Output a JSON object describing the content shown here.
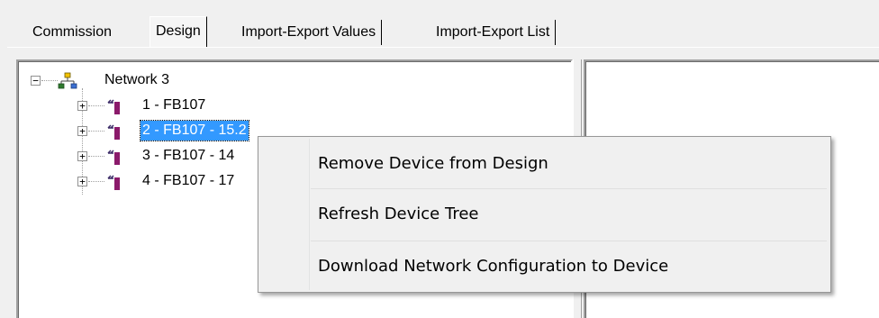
{
  "tabs": [
    {
      "label": "Commission",
      "active": false
    },
    {
      "label": "Design",
      "active": true
    },
    {
      "label": "Import-Export Values",
      "active": false
    },
    {
      "label": "Import-Export List",
      "active": false
    }
  ],
  "tree": {
    "root": {
      "label": "Network 3",
      "icon": "network-icon",
      "expanded": true
    },
    "devices": [
      {
        "label": "1 - FB107",
        "icon": "device-icon",
        "selected": false
      },
      {
        "label": "2 - FB107 - 15.2",
        "icon": "device-icon",
        "selected": true
      },
      {
        "label": "3 - FB107 - 14",
        "icon": "device-icon",
        "selected": false
      },
      {
        "label": "4 - FB107 - 17",
        "icon": "device-icon",
        "selected": false
      }
    ]
  },
  "context_menu": {
    "items": [
      {
        "label": "Remove Device from Design"
      },
      {
        "label": "Refresh Device Tree"
      },
      {
        "label": "Download Network Configuration to Device"
      }
    ]
  },
  "colors": {
    "selection": "#3399ff",
    "device_icon_body": "#8b1a6b",
    "network_icon": "#2f7a2f"
  }
}
